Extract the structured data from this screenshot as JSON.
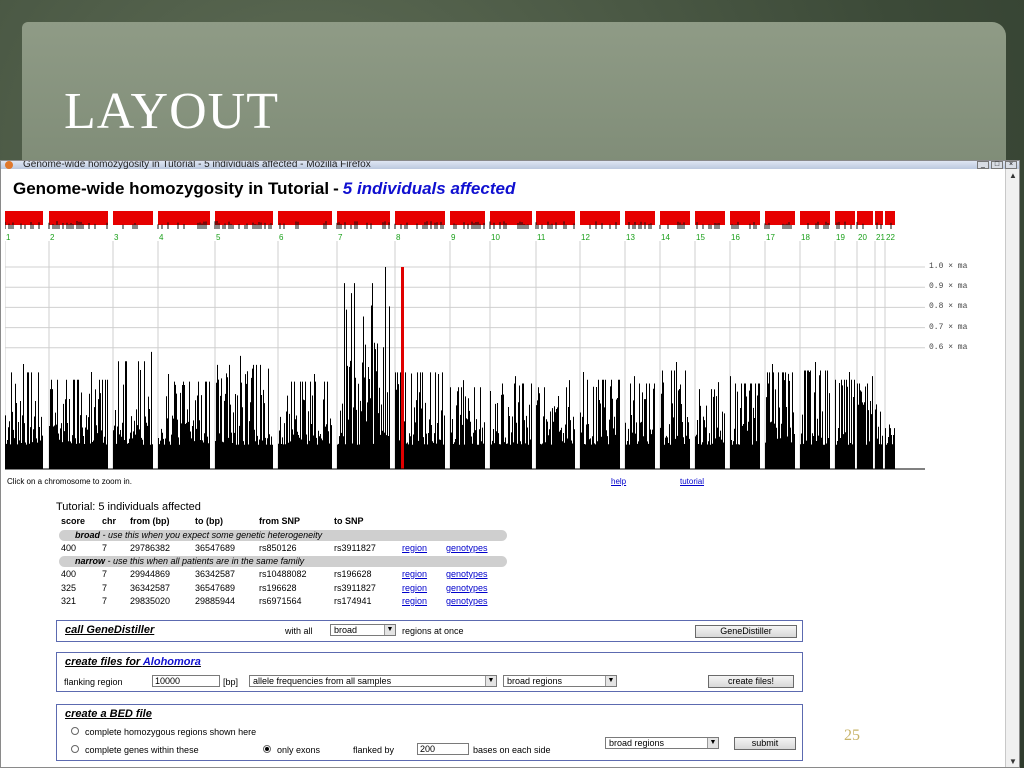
{
  "slide": {
    "title": "LAYOUT",
    "page_number": "25"
  },
  "browser": {
    "window_title": "Genome-wide homozygosity in Tutorial - 5 individuals affected - Mozilla Firefox",
    "min_label": "_",
    "max_label": "□",
    "close_label": "×"
  },
  "page": {
    "heading_main": "Genome-wide homozygosity in Tutorial",
    "heading_sep": "-",
    "heading_highlight": "5 individuals affected",
    "hint": "Click on a chromosome to zoom in.",
    "help_link": "help",
    "tutorial_link": "tutorial"
  },
  "chart_data": {
    "type": "bar",
    "categories": [
      "1",
      "2",
      "3",
      "4",
      "5",
      "6",
      "7",
      "8",
      "9",
      "10",
      "11",
      "12",
      "13",
      "14",
      "15",
      "16",
      "17",
      "18",
      "19",
      "20",
      "21",
      "22"
    ],
    "threshold_labels": [
      "1.0 × ma",
      "0.9 × ma",
      "0.8 × ma",
      "0.7 × ma",
      "0.6 × ma"
    ],
    "thresholds": [
      1.0,
      0.9,
      0.8,
      0.7,
      0.6
    ],
    "highlight_chromosome": "7",
    "highlight_value": 1.0,
    "peak_values": [
      0.52,
      0.48,
      0.58,
      0.47,
      0.56,
      0.47,
      1.0,
      0.52,
      0.44,
      0.46,
      0.44,
      0.48,
      0.46,
      0.53,
      0.43,
      0.46,
      0.52,
      0.53,
      0.48,
      0.46,
      0.32,
      0.22
    ],
    "ylim": [
      0,
      1.0
    ],
    "colors": {
      "bars": "#000000",
      "highlight": "#e00000",
      "ideogram": "#e60000",
      "chr_labels": "#1aa01a"
    }
  },
  "results": {
    "title": "Tutorial: 5 individuals affected",
    "columns": [
      "score",
      "chr",
      "from (bp)",
      "to (bp)",
      "from SNP",
      "to SNP"
    ],
    "region_link": "region",
    "genotypes_link": "genotypes",
    "groups": [
      {
        "label": "broad",
        "description": " - use this when you expect some genetic heterogeneity",
        "rows": [
          [
            "400",
            "7",
            "29786382",
            "36547689",
            "rs850126",
            "rs3911827"
          ]
        ]
      },
      {
        "label": "narrow",
        "description": " - use this when all patients are in the same family",
        "rows": [
          [
            "400",
            "7",
            "29944869",
            "36342587",
            "rs10488082",
            "rs196628"
          ],
          [
            "325",
            "7",
            "36342587",
            "36547689",
            "rs196628",
            "rs3911827"
          ],
          [
            "321",
            "7",
            "29835020",
            "29885944",
            "rs6971564",
            "rs174941"
          ]
        ]
      }
    ]
  },
  "genedistiller": {
    "title": "call GeneDistiller",
    "with_all": "with all",
    "select_value": "broad",
    "regions_at_once": "regions at once",
    "button": "GeneDistiller"
  },
  "alohomora": {
    "title_prefix": "create files for ",
    "title_accent": "Alohomora",
    "flanking_label": "flanking region",
    "flanking_value": "10000",
    "bp_label": "[bp]",
    "freq_select": "allele frequencies from all samples",
    "regions_select": "broad regions",
    "button": "create files!"
  },
  "bed": {
    "title": "create a BED file",
    "option1": "complete homozygous regions shown here",
    "option2": "complete genes within these",
    "only_exons": "only exons",
    "flanked_by": "flanked by",
    "flank_value": "200",
    "bases_label": "bases on each side",
    "regions_select": "broad regions",
    "button": "submit"
  }
}
